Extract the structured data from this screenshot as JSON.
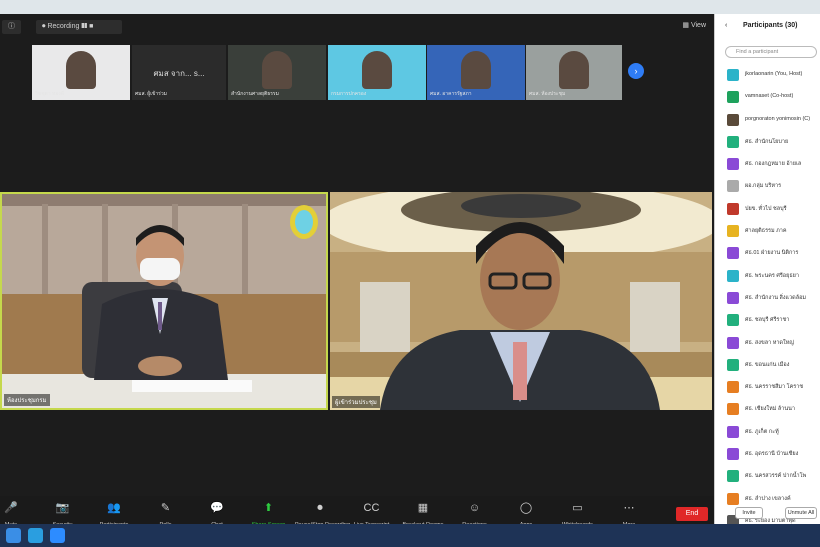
{
  "window": {
    "title_tag": "Recording",
    "view_label": "View"
  },
  "gallery": [
    {
      "name": "วิชชุตา ทองดี",
      "bg": "#e9e9ea"
    },
    {
      "name": "ศมส. ผู้เข้าร่วม",
      "bg": "#2b2b2b",
      "text": "ศมส จาก...   s..."
    },
    {
      "name": "สำนักงานศาลยุติธรรม",
      "bg": "#3a3f3a"
    },
    {
      "name": "กรมการปกครอง",
      "bg": "#5ec8e3"
    },
    {
      "name": "ศมส. อาคารรัฐสภา",
      "bg": "#3565b8"
    },
    {
      "name": "ศมส. ห้องประชุม",
      "bg": "#9aa09e"
    }
  ],
  "videos": {
    "left_name": "ห้องประชุมกรม",
    "right_name": "ผู้เข้าร่วมประชุม"
  },
  "toolbar": {
    "tools": [
      {
        "icon": "🎤",
        "label": "Mute"
      },
      {
        "icon": "📷",
        "label": "Security"
      },
      {
        "icon": "👥",
        "label": "Participants"
      },
      {
        "icon": "✎",
        "label": "Polls"
      },
      {
        "icon": "💬",
        "label": "Chat"
      },
      {
        "icon": "⬆",
        "label": "Share Screen"
      },
      {
        "icon": "⏺",
        "label": "Pause/Stop Recording"
      },
      {
        "icon": "CC",
        "label": "Live Transcript"
      },
      {
        "icon": "▦",
        "label": "Breakout Rooms"
      },
      {
        "icon": "☺",
        "label": "Reactions"
      },
      {
        "icon": "◯",
        "label": "Apps"
      },
      {
        "icon": "▭",
        "label": "Whiteboards"
      },
      {
        "icon": "⋯",
        "label": "More"
      }
    ],
    "end_label": "End"
  },
  "participants_panel": {
    "title": "Participants (30)",
    "search_placeholder": "Find a participant",
    "items": [
      {
        "name": "jkorlaonarin (You, Host)",
        "color": "#2bb3c9"
      },
      {
        "name": "vamnaset (Co-host)",
        "color": "#1ea25d"
      },
      {
        "name": "porgnoraton yonimosin (C)",
        "color": "#5a4a3a"
      },
      {
        "name": "ศธ. สำนักนโยบาย",
        "color": "#22b07d"
      },
      {
        "name": "ศธ. กองกฎหมาย อ้ายเล",
        "color": "#8a4ad6"
      },
      {
        "name": "ผอ.กลุ่ม บริหาร",
        "color": "#aaaaaa"
      },
      {
        "name": "ปยข. ทั่วไป ชลบุรี",
        "color": "#c0392b"
      },
      {
        "name": "ศาลยุติธรรม ภาค",
        "color": "#e7b321"
      },
      {
        "name": "ศธ.01 ฝ่ายงาน นิติการ",
        "color": "#8a4ad6"
      },
      {
        "name": "ศธ. พระนคร ศรีอยุธยา",
        "color": "#2bb3c9"
      },
      {
        "name": "ศธ. สำนักงาน สิ่งแวดล้อม",
        "color": "#8a4ad6"
      },
      {
        "name": "ศธ. ชลบุรี ศรีราชา",
        "color": "#22b07d"
      },
      {
        "name": "ศธ. สงขลา หาดใหญ่",
        "color": "#8a4ad6"
      },
      {
        "name": "ศธ. ขอนแก่น เมือง",
        "color": "#22b07d"
      },
      {
        "name": "ศธ. นครราชสีมา โคราช",
        "color": "#e67e22"
      },
      {
        "name": "ศธ. เชียงใหม่ ล้านนา",
        "color": "#e67e22"
      },
      {
        "name": "ศธ. ภูเก็ต กะทู้",
        "color": "#8a4ad6"
      },
      {
        "name": "ศธ. อุดรธานี บ้านเชียง",
        "color": "#8a4ad6"
      },
      {
        "name": "ศธ. นครสวรรค์ ปากน้ำโพ",
        "color": "#22b07d"
      },
      {
        "name": "ศธ. ลำปาง เขลางค์",
        "color": "#e67e22"
      },
      {
        "name": "ศธ. ระยอง มาบตาพุด",
        "color": "#555555"
      }
    ],
    "invite_label": "Invite",
    "unmute_label": "Unmute All"
  },
  "taskbar": {
    "apps": [
      {
        "icon": "windows-start-icon",
        "color": "#3a8ee6"
      },
      {
        "icon": "edge-browser-icon",
        "color": "#2a9ee0"
      },
      {
        "icon": "zoom-app-icon",
        "color": "#2d8cff"
      }
    ]
  }
}
